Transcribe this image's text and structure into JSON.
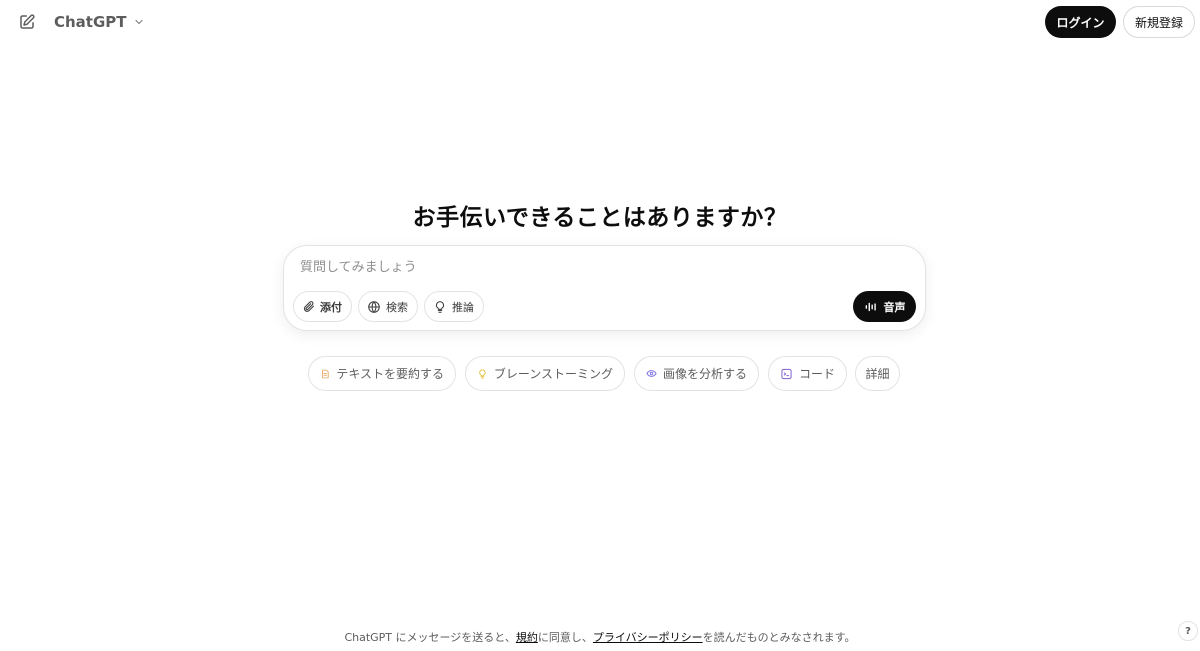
{
  "header": {
    "model_name": "ChatGPT",
    "login_label": "ログイン",
    "signup_label": "新規登録"
  },
  "main": {
    "headline": "お手伝いできることはありますか？",
    "composer": {
      "placeholder": "質問してみましょう",
      "value": "",
      "tools": {
        "attach_label": "添付",
        "search_label": "検索",
        "reason_label": "推論"
      },
      "voice_label": "音声"
    },
    "suggestions": {
      "summarize": "テキストを要約する",
      "brainstorm": "ブレーンストーミング",
      "analyze_image": "画像を分析する",
      "code": "コード",
      "more": "詳細"
    }
  },
  "footer": {
    "text_before": "ChatGPT にメッセージを送ると、",
    "terms_link": "規約",
    "text_middle": "に同意し、",
    "privacy_link": "プライバシーポリシー",
    "text_after": "を読んだものとみなされます。",
    "help_label": "?"
  },
  "icons": {
    "new_chat": "compose-icon",
    "model_dropdown": "chevron-down-icon",
    "attach": "paperclip-icon",
    "search": "globe-icon",
    "reason": "lightbulb-icon",
    "voice": "waveform-icon",
    "summarize": "document-icon",
    "brainstorm": "lightbulb-icon",
    "analyze_image": "eye-icon",
    "code": "terminal-icon"
  },
  "colors": {
    "primary_button": "#0d0d0d",
    "summarize_icon": "#e8a35a",
    "brainstorm_icon": "#e3c23b",
    "analyze_icon": "#7a6ee0",
    "code_icon": "#8a6fd6"
  }
}
